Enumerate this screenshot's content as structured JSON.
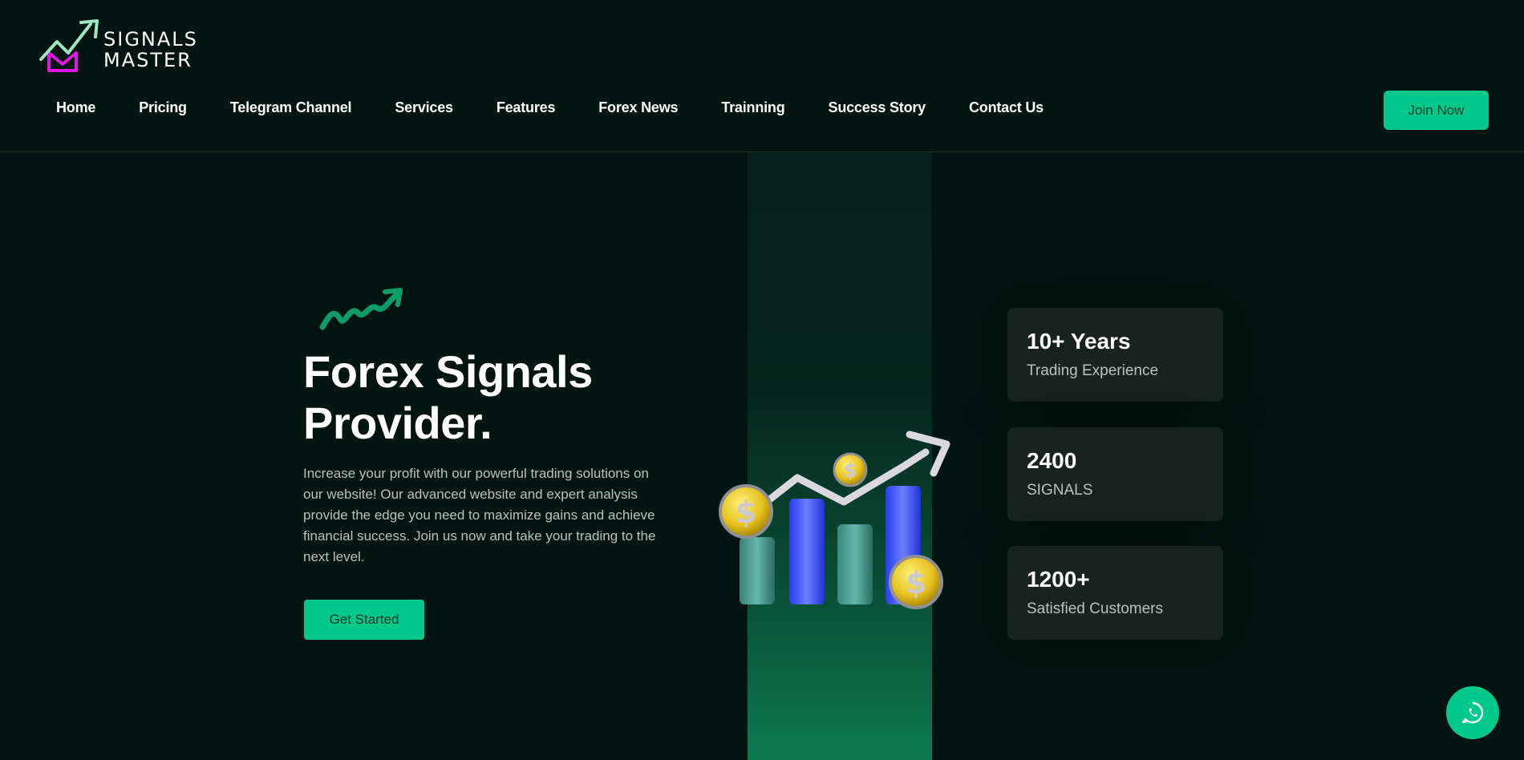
{
  "brand": {
    "line1": "SIGNALS",
    "line2": "MASTER",
    "logo_icon": "trend-up-arrow",
    "colors": {
      "logo_arrow": "#9ee6c4",
      "logo_box": "#e414e4"
    }
  },
  "nav": {
    "items": [
      {
        "label": "Home"
      },
      {
        "label": "Pricing"
      },
      {
        "label": "Telegram Channel"
      },
      {
        "label": "Services"
      },
      {
        "label": "Features"
      },
      {
        "label": "Forex News"
      },
      {
        "label": "Trainning"
      },
      {
        "label": "Success Story"
      },
      {
        "label": "Contact Us"
      }
    ],
    "join_label": "Join Now"
  },
  "hero": {
    "title_line1": "Forex Signals",
    "title_line2": "Provider.",
    "description": "Increase your profit with our powerful trading solutions on our website! Our advanced website and expert analysis provide the edge you need to maximize gains and achieve financial success. Join us now and take your trading to the next level.",
    "cta_label": "Get Started",
    "decor_icon": "zigzag-arrow-icon",
    "illustration": "bar-chart-with-coins"
  },
  "stats": [
    {
      "value": "10+ Years",
      "label": "Trading Experience"
    },
    {
      "value": "2400",
      "label": "SIGNALS"
    },
    {
      "value": "1200+",
      "label": "Satisfied Customers"
    }
  ],
  "floating": {
    "icon": "whatsapp-icon"
  },
  "colors": {
    "background": "#031510",
    "accent": "#00c98b",
    "card": "#16231f",
    "muted_text": "#b7c3bf"
  }
}
